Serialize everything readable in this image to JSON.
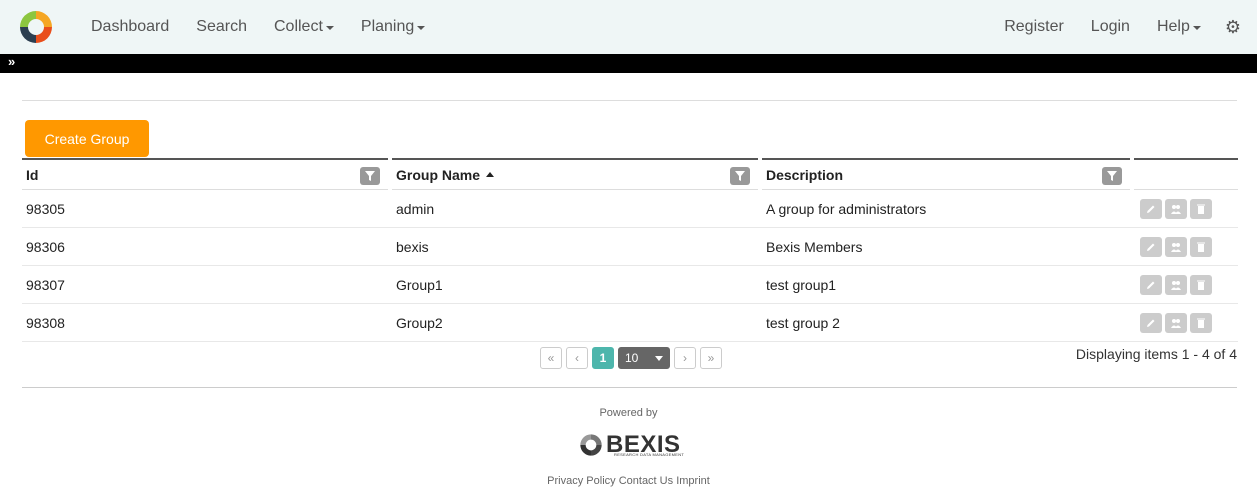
{
  "nav": {
    "left": [
      {
        "label": "Dashboard",
        "dropdown": false
      },
      {
        "label": "Search",
        "dropdown": false
      },
      {
        "label": "Collect",
        "dropdown": true
      },
      {
        "label": "Planing",
        "dropdown": true
      }
    ],
    "right": [
      {
        "label": "Register",
        "dropdown": false
      },
      {
        "label": "Login",
        "dropdown": false
      },
      {
        "label": "Help",
        "dropdown": true
      }
    ],
    "settings_icon": "gear-icon",
    "logo_icon": "bexis-logo"
  },
  "toggle_icon": "double-chevron-down-icon",
  "create_button": "Create Group",
  "grid": {
    "columns": [
      {
        "label": "Id",
        "filter": true,
        "sort": ""
      },
      {
        "label": "Group Name",
        "filter": true,
        "sort": "asc"
      },
      {
        "label": "Description",
        "filter": true,
        "sort": ""
      },
      {
        "label": "",
        "filter": false,
        "sort": ""
      }
    ],
    "rows": [
      {
        "id": "98305",
        "name": "admin",
        "description": "A group for administrators"
      },
      {
        "id": "98306",
        "name": "bexis",
        "description": "Bexis Members"
      },
      {
        "id": "98307",
        "name": "Group1",
        "description": "test group1"
      },
      {
        "id": "98308",
        "name": "Group2",
        "description": "test group 2"
      }
    ],
    "row_actions": [
      "edit-icon",
      "members-icon",
      "delete-icon"
    ]
  },
  "pager": {
    "first": "«",
    "prev": "‹",
    "current_page": "1",
    "page_size": "10",
    "next": "›",
    "last": "»",
    "status": "Displaying items 1 - 4 of 4"
  },
  "footer": {
    "powered_by": "Powered by",
    "logo_text": "BEXIS",
    "logo_subtitle": "RESEARCH DATA MANAGEMENT",
    "links": [
      "Privacy Policy",
      "Contact Us",
      "Imprint"
    ]
  },
  "colors": {
    "accent": "#ff9800",
    "pager_active": "#4db6ac",
    "navbar_bg": "#eff6f6"
  }
}
